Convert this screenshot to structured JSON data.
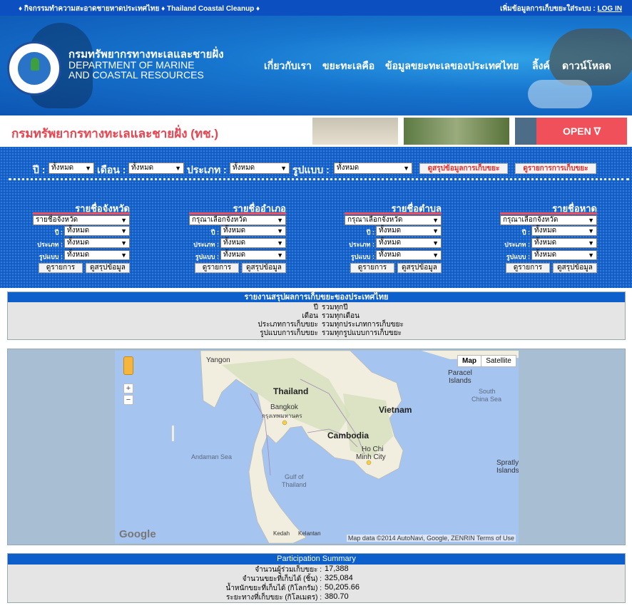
{
  "topbar": {
    "left_text": "♦ กิจกรรมทำความสะอาดชายหาดประเทศไทย ♦ Thailand Coastal Cleanup ♦",
    "right_text": "เพิ่มข้อมูลการเก็บขยะใส่ระบบ :",
    "login_link": "LOG IN"
  },
  "header": {
    "org_th": "กรมทรัพยากรทางทะเลและชายฝั่ง",
    "org_en_line1": "DEPARTMENT OF MARINE",
    "org_en_line2": "AND COASTAL RESOURCES",
    "nav": [
      "เกี่ยวกับเรา",
      "ขยะทะเลคือ",
      "ข้อมูลขยะทะเลของประเทศไทย",
      "ลิ้งค์",
      "ดาวน์โหลด"
    ]
  },
  "banner": {
    "title": "กรมทรัพยากรทางทะเลและชายฝั่ง (ทช.)",
    "open_label": "OPEN ∇"
  },
  "filters": {
    "year_label": "ปี :",
    "year_value": "ทั้งหมด",
    "month_label": "เดือน :",
    "month_value": "ทั้งหมด",
    "type_label": "ประเภท :",
    "type_value": "ทั้งหมด",
    "format_label": "รูปแบบ :",
    "format_value": "ทั้งหมด",
    "summary_button": "ดูสรุปข้อมูลการเก็บขยะ",
    "list_button": "ดูรายการการเก็บขยะ"
  },
  "columns": [
    {
      "title": "รายชื่อจังหวัด",
      "select": "รายชื่อจังหวัด",
      "year_label": "ปี :",
      "type_label": "ประเภท :",
      "format_label": "รูปแบบ :",
      "value": "ทั้งหมด",
      "list_btn": "ดูรายการ",
      "summary_btn": "ดูสรุปข้อมูล"
    },
    {
      "title": "รายชื่ออำเภอ",
      "select": "กรุณาเลือกจังหวัด",
      "year_label": "ปี :",
      "type_label": "ประเภท :",
      "format_label": "รูปแบบ :",
      "value": "ทั้งหมด",
      "list_btn": "ดูรายการ",
      "summary_btn": "ดูสรุปข้อมูล"
    },
    {
      "title": "รายชื่อตำบล",
      "select": "กรุณาเลือกจังหวัด",
      "year_label": "ปี :",
      "type_label": "ประเภท :",
      "format_label": "รูปแบบ :",
      "value": "ทั้งหมด",
      "list_btn": "ดูรายการ",
      "summary_btn": "ดูสรุปข้อมูล"
    },
    {
      "title": "รายชื่อหาด",
      "select": "กรุณาเลือกจังหวัด",
      "year_label": "ปี :",
      "type_label": "ประเภท :",
      "format_label": "รูปแบบ :",
      "value": "ทั้งหมด",
      "list_btn": "ดูรายการ",
      "summary_btn": "ดูสรุปข้อมูล"
    }
  ],
  "report": {
    "title": "รายงานสรุปผลการเก็บขยะของประเทศไทย",
    "rows": [
      {
        "key": "ปี",
        "value": "รวมทุกปี"
      },
      {
        "key": "เดือน",
        "value": "รวมทุกเดือน"
      },
      {
        "key": "ประเภทการเก็บขยะ",
        "value": "รวมทุกประเภทการเก็บขยะ"
      },
      {
        "key": "รูปแบบการเก็บขยะ",
        "value": "รวมทุกรูปแบบการเก็บขยะ"
      }
    ]
  },
  "map": {
    "map_btn": "Map",
    "satellite_btn": "Satellite",
    "labels": {
      "yangon": "Yangon",
      "thailand": "Thailand",
      "bangkok": "Bangkok",
      "bangkok_th": "กรุงเทพมหานคร",
      "vietnam": "Vietnam",
      "cambodia": "Cambodia",
      "hochiminh1": "Ho Chi",
      "hochiminh2": "Minh City",
      "andaman": "Andaman Sea",
      "gulf1": "Gulf of",
      "gulf2": "Thailand",
      "paracel1": "Paracel",
      "paracel2": "Islands",
      "scs1": "South",
      "scs2": "China Sea",
      "spratly1": "Spratly",
      "spratly2": "Islands",
      "kedah": "Kedah",
      "kelantan": "Kelantan"
    },
    "footer": "Map data ©2014 AutoNavi, Google, ZENRIN    Terms of Use",
    "google": "Google",
    "zoom_in": "+",
    "zoom_out": "−"
  },
  "participation": {
    "title": "Participation Summary",
    "rows": [
      {
        "key": "จำนวนผู้ร่วมเก็บขยะ :",
        "value": "17,388"
      },
      {
        "key": "จำนวนขยะที่เก็บได้ (ชิ้น) :",
        "value": "325,084"
      },
      {
        "key": "น้ำหนักขยะที่เก็บได้ (กิโลกรัม) :",
        "value": "50,205.66"
      },
      {
        "key": "ระยะทางที่เก็บขยะ (กิโลเมตร) :",
        "value": "380.70"
      }
    ]
  }
}
